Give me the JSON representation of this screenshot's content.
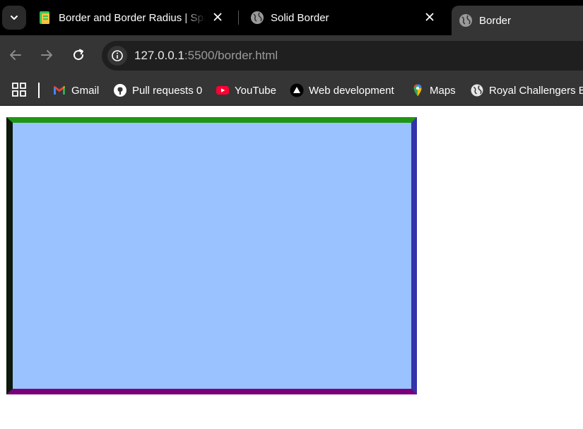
{
  "tabs": [
    {
      "title": "Border and Border Radius | Spa",
      "favicon": "course-site-icon",
      "closable": true,
      "active": false
    },
    {
      "title": "Solid Border",
      "favicon": "globe-icon",
      "closable": true,
      "active": false
    },
    {
      "title": "Border",
      "favicon": "globe-icon",
      "closable": false,
      "active": true
    }
  ],
  "toolbar": {
    "url_host": "127.0.0.1",
    "url_rest": ":5500/border.html",
    "back_icon": "arrow-left-icon",
    "forward_icon": "arrow-right-icon",
    "reload_icon": "reload-icon",
    "site_info_icon": "info-icon"
  },
  "bookmarks": [
    {
      "label": "Gmail",
      "icon": "gmail-icon"
    },
    {
      "label": "Pull requests 0",
      "icon": "github-icon"
    },
    {
      "label": "YouTube",
      "icon": "youtube-icon"
    },
    {
      "label": "Web development",
      "icon": "triangle-logo-icon"
    },
    {
      "label": "Maps",
      "icon": "maps-pin-icon"
    },
    {
      "label": "Royal Challengers B...",
      "icon": "globe-icon"
    }
  ],
  "page": {
    "box": {
      "background": "#99c2ff",
      "border_top_color": "#1f9514",
      "border_right_color": "#3333aa",
      "border_bottom_color": "#7a007a",
      "border_left_color": "#0c190c"
    }
  }
}
